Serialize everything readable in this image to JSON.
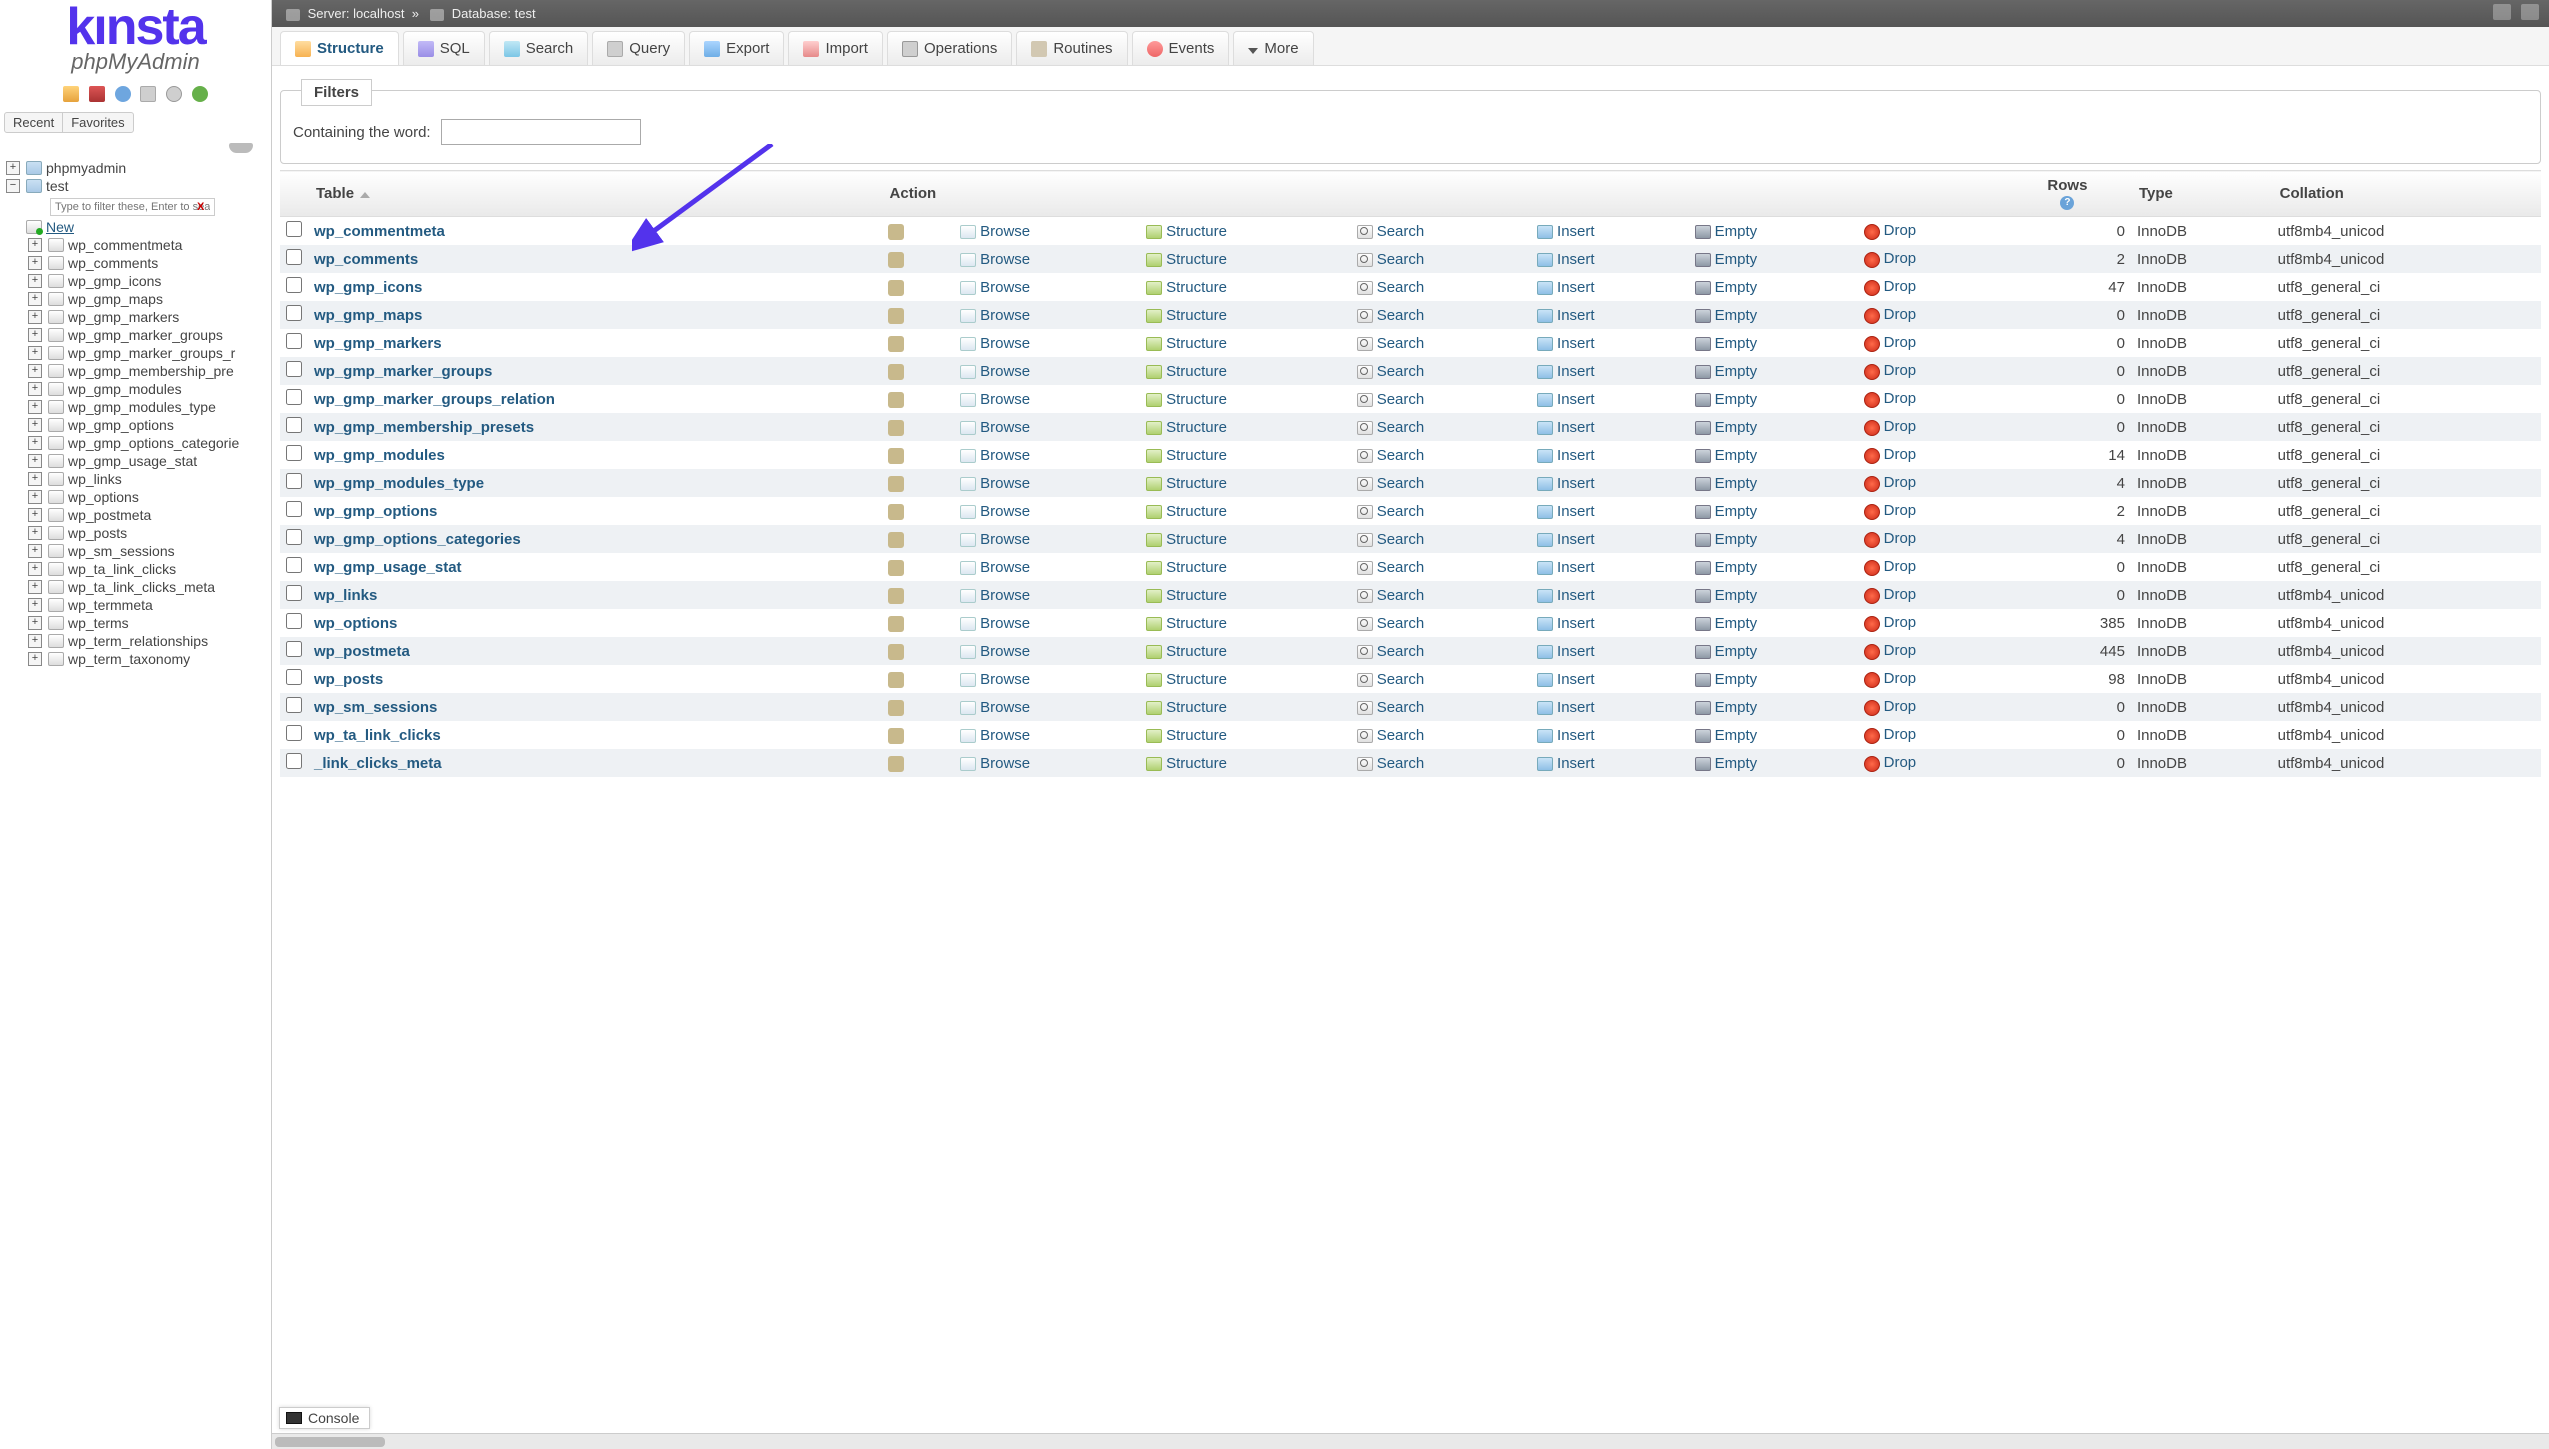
{
  "breadcrumb": {
    "server_label": "Server:",
    "server": "localhost",
    "db_label": "Database:",
    "db": "test"
  },
  "sidebar": {
    "recent": "Recent",
    "favorites": "Favorites",
    "root": "phpmyadmin",
    "db": "test",
    "filter_placeholder": "Type to filter these, Enter to search",
    "new": "New",
    "tables": [
      "wp_commentmeta",
      "wp_comments",
      "wp_gmp_icons",
      "wp_gmp_maps",
      "wp_gmp_markers",
      "wp_gmp_marker_groups",
      "wp_gmp_marker_groups_r",
      "wp_gmp_membership_pre",
      "wp_gmp_modules",
      "wp_gmp_modules_type",
      "wp_gmp_options",
      "wp_gmp_options_categorie",
      "wp_gmp_usage_stat",
      "wp_links",
      "wp_options",
      "wp_postmeta",
      "wp_posts",
      "wp_sm_sessions",
      "wp_ta_link_clicks",
      "wp_ta_link_clicks_meta",
      "wp_termmeta",
      "wp_terms",
      "wp_term_relationships",
      "wp_term_taxonomy"
    ]
  },
  "tabs": {
    "structure": "Structure",
    "sql": "SQL",
    "search": "Search",
    "query": "Query",
    "export": "Export",
    "import": "Import",
    "operations": "Operations",
    "routines": "Routines",
    "events": "Events",
    "more": "More"
  },
  "filters": {
    "legend": "Filters",
    "label": "Containing the word:"
  },
  "grid": {
    "headers": {
      "table": "Table",
      "action": "Action",
      "rows": "Rows",
      "type": "Type",
      "collation": "Collation"
    },
    "action_labels": {
      "browse": "Browse",
      "structure": "Structure",
      "search": "Search",
      "insert": "Insert",
      "empty": "Empty",
      "drop": "Drop"
    },
    "rows": [
      {
        "name": "wp_commentmeta",
        "rows": 0,
        "type": "InnoDB",
        "coll": "utf8mb4_unicod"
      },
      {
        "name": "wp_comments",
        "rows": 2,
        "type": "InnoDB",
        "coll": "utf8mb4_unicod"
      },
      {
        "name": "wp_gmp_icons",
        "rows": 47,
        "type": "InnoDB",
        "coll": "utf8_general_ci"
      },
      {
        "name": "wp_gmp_maps",
        "rows": 0,
        "type": "InnoDB",
        "coll": "utf8_general_ci"
      },
      {
        "name": "wp_gmp_markers",
        "rows": 0,
        "type": "InnoDB",
        "coll": "utf8_general_ci"
      },
      {
        "name": "wp_gmp_marker_groups",
        "rows": 0,
        "type": "InnoDB",
        "coll": "utf8_general_ci"
      },
      {
        "name": "wp_gmp_marker_groups_relation",
        "rows": 0,
        "type": "InnoDB",
        "coll": "utf8_general_ci"
      },
      {
        "name": "wp_gmp_membership_presets",
        "rows": 0,
        "type": "InnoDB",
        "coll": "utf8_general_ci"
      },
      {
        "name": "wp_gmp_modules",
        "rows": 14,
        "type": "InnoDB",
        "coll": "utf8_general_ci"
      },
      {
        "name": "wp_gmp_modules_type",
        "rows": 4,
        "type": "InnoDB",
        "coll": "utf8_general_ci"
      },
      {
        "name": "wp_gmp_options",
        "rows": 2,
        "type": "InnoDB",
        "coll": "utf8_general_ci"
      },
      {
        "name": "wp_gmp_options_categories",
        "rows": 4,
        "type": "InnoDB",
        "coll": "utf8_general_ci"
      },
      {
        "name": "wp_gmp_usage_stat",
        "rows": 0,
        "type": "InnoDB",
        "coll": "utf8_general_ci"
      },
      {
        "name": "wp_links",
        "rows": 0,
        "type": "InnoDB",
        "coll": "utf8mb4_unicod"
      },
      {
        "name": "wp_options",
        "rows": 385,
        "type": "InnoDB",
        "coll": "utf8mb4_unicod"
      },
      {
        "name": "wp_postmeta",
        "rows": 445,
        "type": "InnoDB",
        "coll": "utf8mb4_unicod"
      },
      {
        "name": "wp_posts",
        "rows": 98,
        "type": "InnoDB",
        "coll": "utf8mb4_unicod"
      },
      {
        "name": "wp_sm_sessions",
        "rows": 0,
        "type": "InnoDB",
        "coll": "utf8mb4_unicod"
      },
      {
        "name": "wp_ta_link_clicks",
        "rows": 0,
        "type": "InnoDB",
        "coll": "utf8mb4_unicod"
      },
      {
        "name": "_link_clicks_meta",
        "rows": 0,
        "type": "InnoDB",
        "coll": "utf8mb4_unicod"
      }
    ]
  },
  "console": "Console"
}
